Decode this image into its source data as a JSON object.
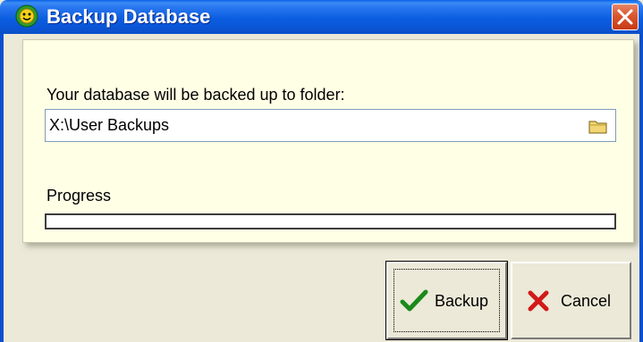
{
  "window": {
    "title": "Backup Database"
  },
  "panel": {
    "folder_label": "Your database will be backed up to folder:",
    "folder_path": "X:\\User Backups",
    "progress_label": "Progress",
    "progress_value": 0
  },
  "buttons": {
    "backup_label": "Backup",
    "cancel_label": "Cancel"
  },
  "icons": {
    "app": "app-icon",
    "close": "close-icon",
    "folder": "folder-icon",
    "backup": "checkmark-icon",
    "cancel": "x-icon"
  },
  "colors": {
    "titlebar": "#0b5ee0",
    "panel_bg": "#ffffe6",
    "dialog_bg": "#ece9d8",
    "close_btn": "#d9562f",
    "check": "#1a8a1a",
    "cancel_x": "#d11a1a"
  }
}
